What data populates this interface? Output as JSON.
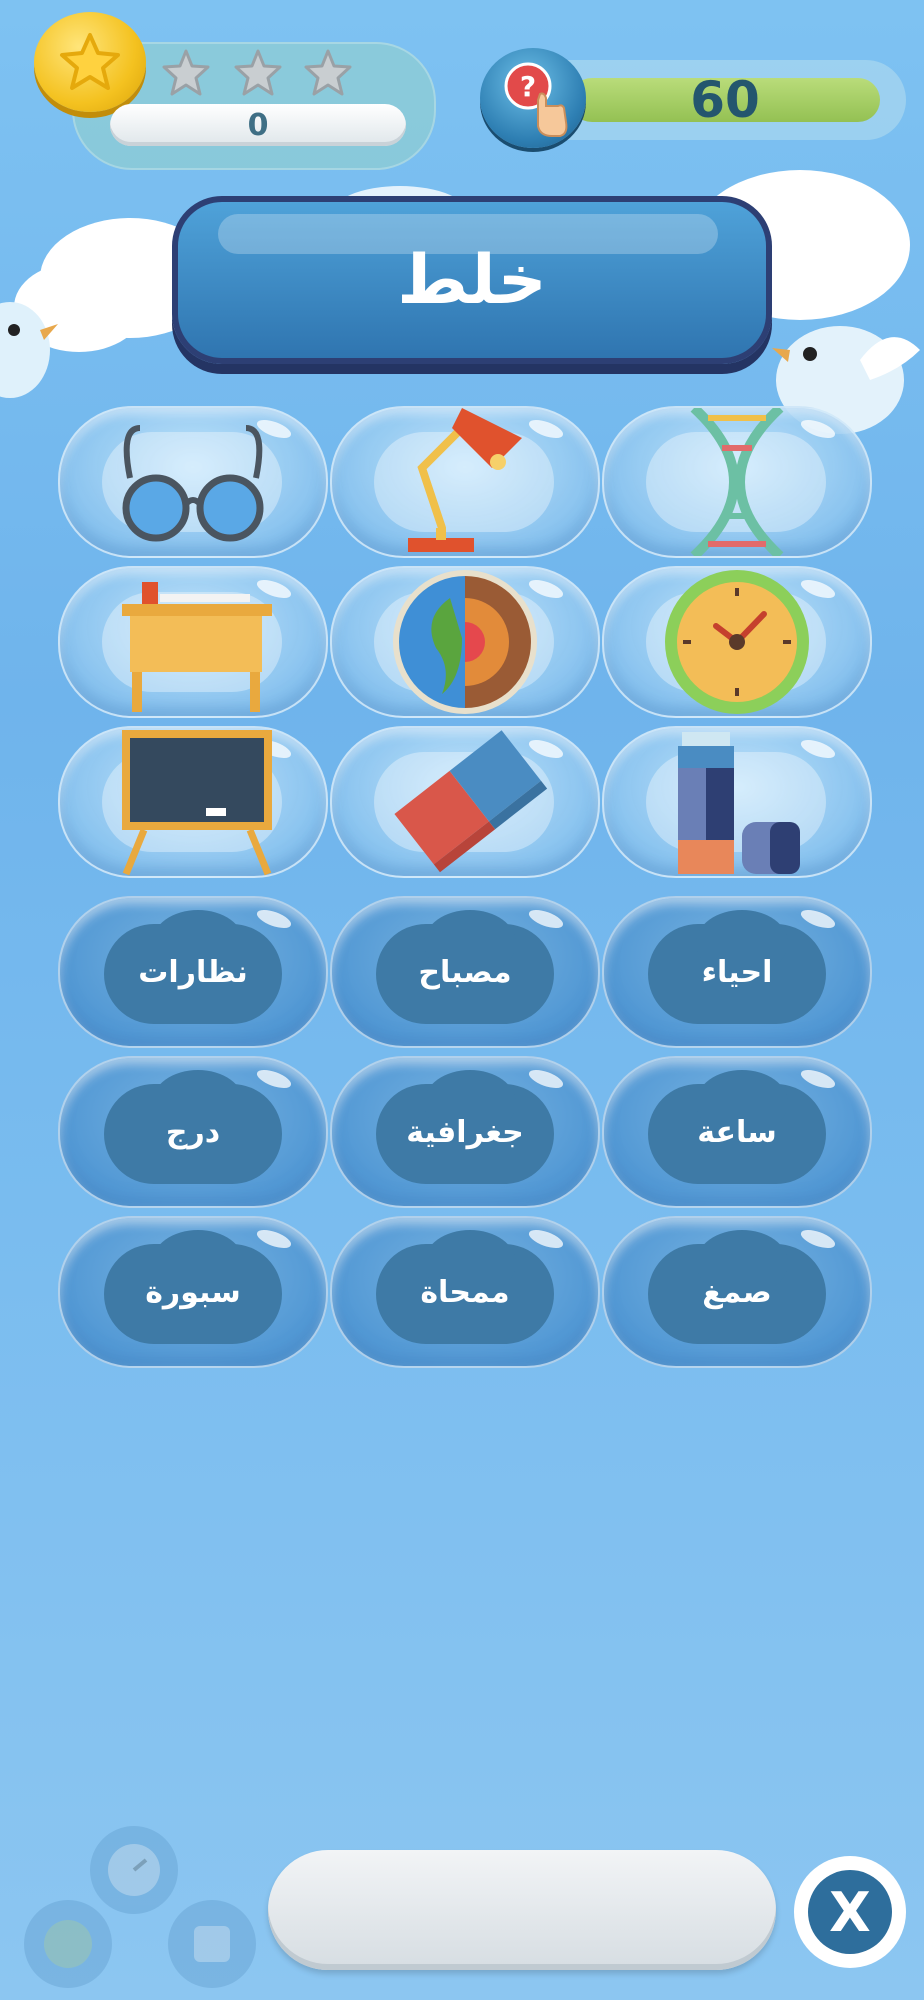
{
  "hud": {
    "score": "0",
    "stars_earned": 0,
    "stars_total": 3,
    "timer": "60",
    "coin_icon": "star-coin-icon",
    "hint_icon": "hint-question-hand-icon"
  },
  "shuffle": {
    "label": "خلط"
  },
  "pictures": [
    {
      "icon": "glasses-icon"
    },
    {
      "icon": "desk-lamp-icon"
    },
    {
      "icon": "dna-icon"
    },
    {
      "icon": "school-desk-icon"
    },
    {
      "icon": "earth-layers-icon"
    },
    {
      "icon": "clock-icon"
    },
    {
      "icon": "blackboard-icon"
    },
    {
      "icon": "eraser-icon"
    },
    {
      "icon": "glue-stick-icon"
    }
  ],
  "words": [
    "نظارات",
    "مصباح",
    "احياء",
    "درج",
    "جغرافية",
    "ساعة",
    "سبورة",
    "ممحاة",
    "صمغ"
  ],
  "answer": {
    "value": ""
  },
  "close": {
    "label": "X"
  },
  "colors": {
    "background": "#79bcef",
    "banner": "#3f8cc6",
    "timer_bar": "#a5cf65"
  }
}
